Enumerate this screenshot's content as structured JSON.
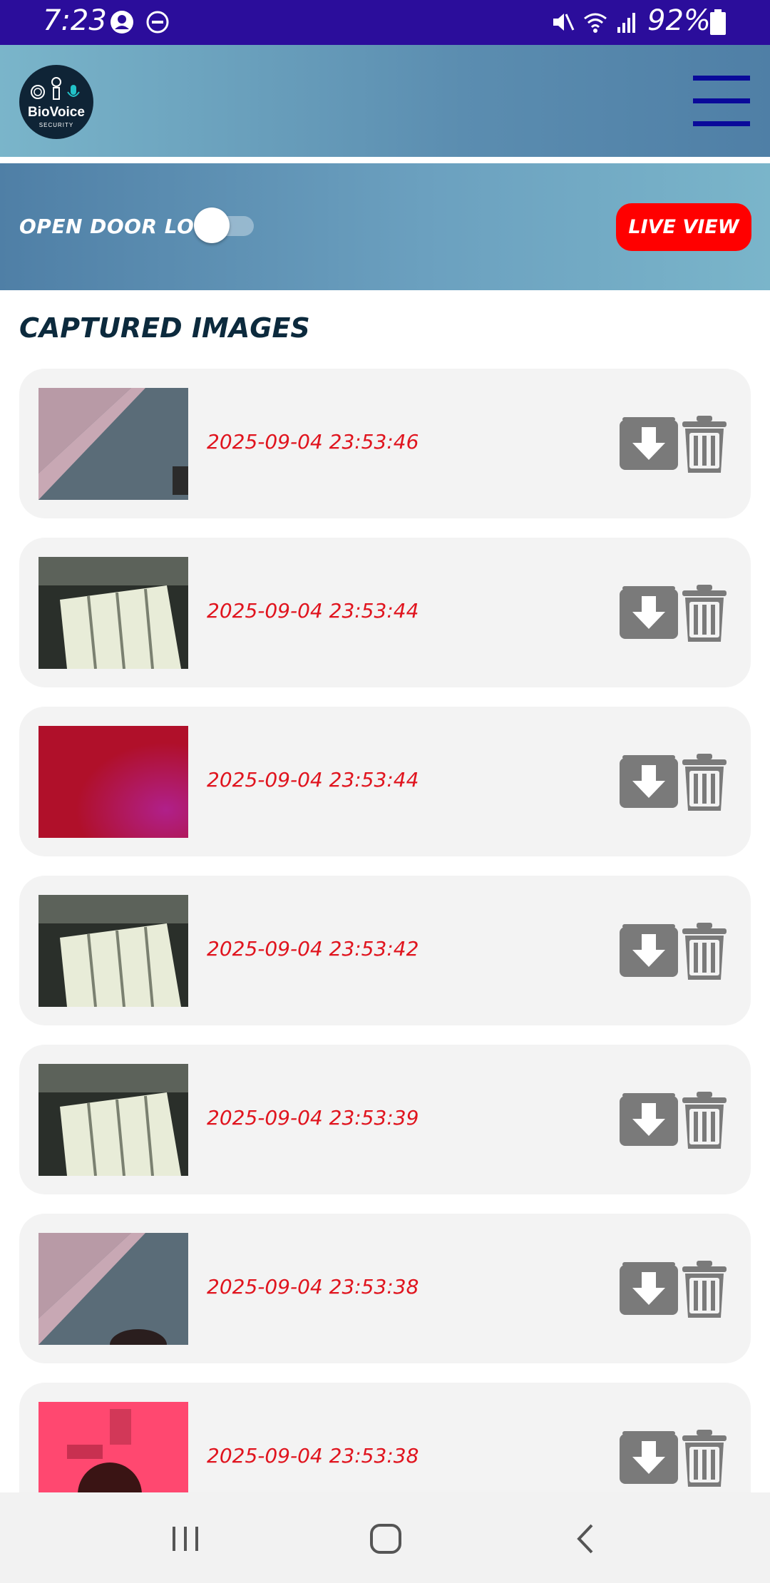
{
  "status_bar": {
    "time": "7:23",
    "battery_percent": "92%",
    "icons": [
      "account-icon",
      "dnd-icon",
      "mute-icon",
      "wifi-icon",
      "signal-icon",
      "battery-icon"
    ]
  },
  "header": {
    "logo_text": "BioVoice",
    "logo_subtext": "SECURITY",
    "menu_icon": "hamburger-menu-icon"
  },
  "controls": {
    "door_lock_label": "OPEN DOOR LOCK",
    "door_lock_on": false,
    "live_view_label": "LIVE VIEW"
  },
  "section_title": "CAPTURED IMAGES",
  "images": [
    {
      "timestamp": "2025-09-04 23:53:46",
      "thumb": "ceiling-pink"
    },
    {
      "timestamp": "2025-09-04 23:53:44",
      "thumb": "ceiling-light"
    },
    {
      "timestamp": "2025-09-04 23:53:44",
      "thumb": "red"
    },
    {
      "timestamp": "2025-09-04 23:53:42",
      "thumb": "ceiling-light"
    },
    {
      "timestamp": "2025-09-04 23:53:39",
      "thumb": "ceiling-light"
    },
    {
      "timestamp": "2025-09-04 23:53:38",
      "thumb": "ceiling-pink-head"
    },
    {
      "timestamp": "2025-09-04 23:53:38",
      "thumb": "red-room"
    }
  ],
  "colors": {
    "status_bar": "#2b0d9b",
    "accent_red": "#ff0000",
    "timestamp_red": "#e0141e",
    "icon_gray": "#7a7a7a",
    "title_dark": "#0c2a3d"
  },
  "nav": {
    "icons": [
      "recents-icon",
      "home-icon",
      "back-icon"
    ]
  }
}
